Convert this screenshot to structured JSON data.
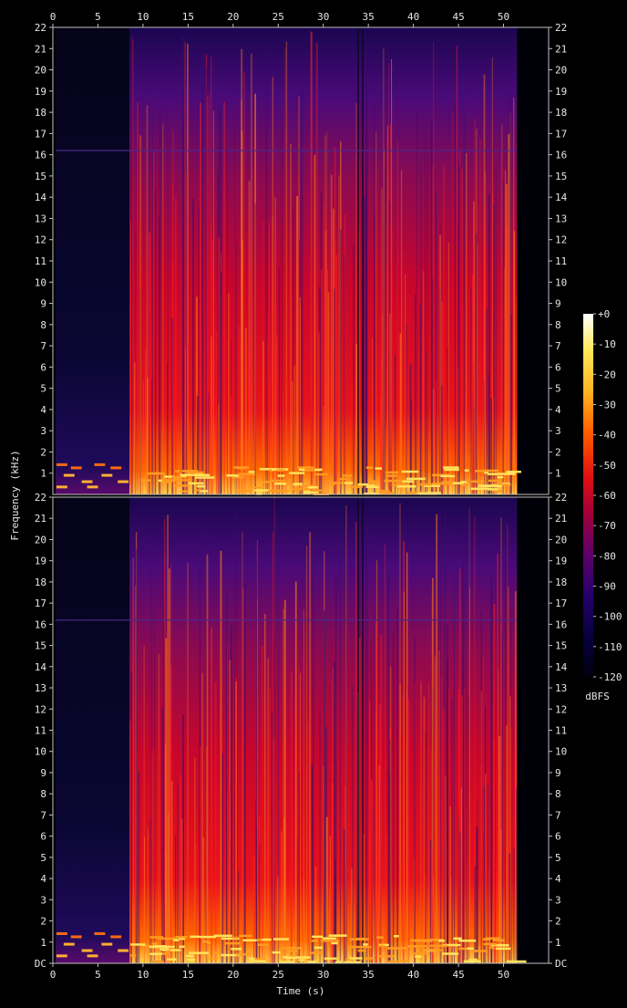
{
  "chart_data": {
    "type": "heatmap",
    "xlabel": "Time (s)",
    "ylabel": "Frequency (kHz)",
    "xlim": [
      0,
      55
    ],
    "ylim": [
      0,
      22
    ],
    "x_ticks": [
      "0",
      "5",
      "10",
      "15",
      "20",
      "25",
      "30",
      "35",
      "40",
      "45",
      "50"
    ],
    "y_ticks": [
      "DC",
      "1",
      "2",
      "3",
      "4",
      "5",
      "6",
      "7",
      "8",
      "9",
      "10",
      "11",
      "12",
      "13",
      "14",
      "15",
      "16",
      "17",
      "18",
      "19",
      "20",
      "21",
      "22"
    ],
    "channels": 2,
    "audio_start_s": 8.5,
    "audio_end_s": 51.5,
    "colorbar": {
      "label": "dBFS",
      "range": [
        -120,
        0
      ],
      "ticks": [
        "+0",
        "-10",
        "-20",
        "-30",
        "-40",
        "-50",
        "-60",
        "-70",
        "-80",
        "-90",
        "-100",
        "-110",
        "-120"
      ],
      "colors": [
        "#ffffff",
        "#ffe85a",
        "#ffb020",
        "#ff5a00",
        "#e01010",
        "#a0003a",
        "#60006a",
        "#24006a",
        "#06003a",
        "#000010"
      ]
    }
  }
}
